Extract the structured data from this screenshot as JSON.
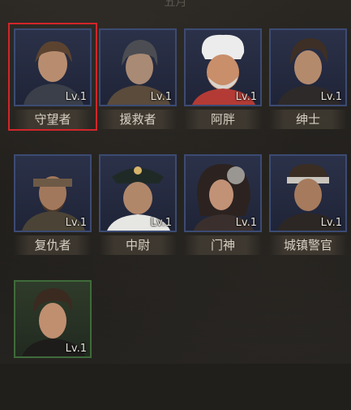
{
  "header": {
    "title": "五月"
  },
  "heroes": [
    {
      "name": "守望者",
      "level": "Lv.1",
      "selected": true,
      "frame": "blue"
    },
    {
      "name": "援救者",
      "level": "Lv.1",
      "selected": false,
      "frame": "blue"
    },
    {
      "name": "阿胖",
      "level": "Lv.1",
      "selected": false,
      "frame": "blue"
    },
    {
      "name": "绅士",
      "level": "Lv.1",
      "selected": false,
      "frame": "blue"
    },
    {
      "name": "复仇者",
      "level": "Lv.1",
      "selected": false,
      "frame": "blue"
    },
    {
      "name": "中尉",
      "level": "Lv.1",
      "selected": false,
      "frame": "blue"
    },
    {
      "name": "门神",
      "level": "Lv.1",
      "selected": false,
      "frame": "blue"
    },
    {
      "name": "城镇警官",
      "level": "Lv.1",
      "selected": false,
      "frame": "blue"
    },
    {
      "name": "",
      "level": "Lv.1",
      "selected": false,
      "frame": "green"
    }
  ],
  "colors": {
    "selected_border": "#d1262a",
    "blue_frame": "#3c4b73",
    "green_frame": "#3f6b3a"
  }
}
